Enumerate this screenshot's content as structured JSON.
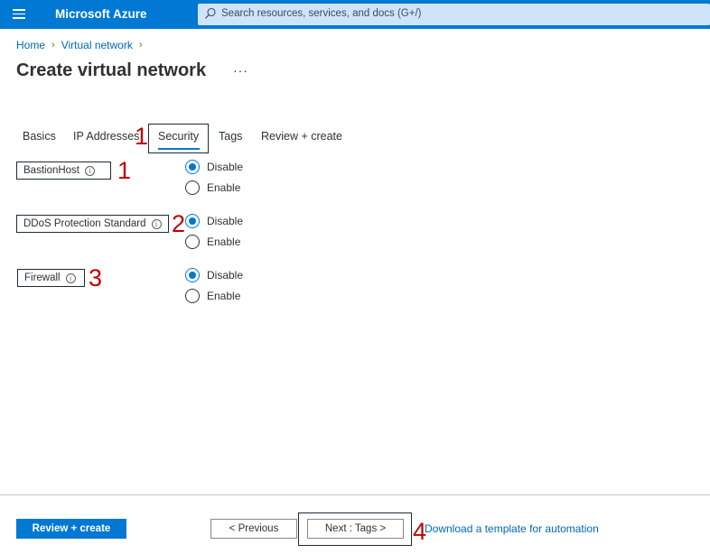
{
  "topbar": {
    "brand": "Microsoft Azure",
    "search_placeholder": "Search resources, services, and docs (G+/)",
    "color": "#0078d4"
  },
  "breadcrumb": {
    "items": [
      "Home",
      "Virtual network"
    ]
  },
  "page": {
    "title": "Create virtual network",
    "more": "···"
  },
  "tabs": [
    {
      "label": "Basics",
      "active": false
    },
    {
      "label": "IP Addresses",
      "active": false
    },
    {
      "label": "Security",
      "active": true
    },
    {
      "label": "Tags",
      "active": false
    },
    {
      "label": "Review + create",
      "active": false
    }
  ],
  "fields": [
    {
      "label": "BastionHost",
      "options": [
        "Disable",
        "Enable"
      ],
      "selected": "Disable"
    },
    {
      "label": "DDoS Protection Standard",
      "options": [
        "Disable",
        "Enable"
      ],
      "selected": "Disable"
    },
    {
      "label": "Firewall",
      "options": [
        "Disable",
        "Enable"
      ],
      "selected": "Disable"
    }
  ],
  "annotations": [
    "1",
    "1",
    "2",
    "3",
    "4"
  ],
  "footer": {
    "review_create": "Review + create",
    "previous": "< Previous",
    "next": "Next : Tags >",
    "download": "Download a template for automation"
  },
  "icons": {
    "info": "i"
  }
}
